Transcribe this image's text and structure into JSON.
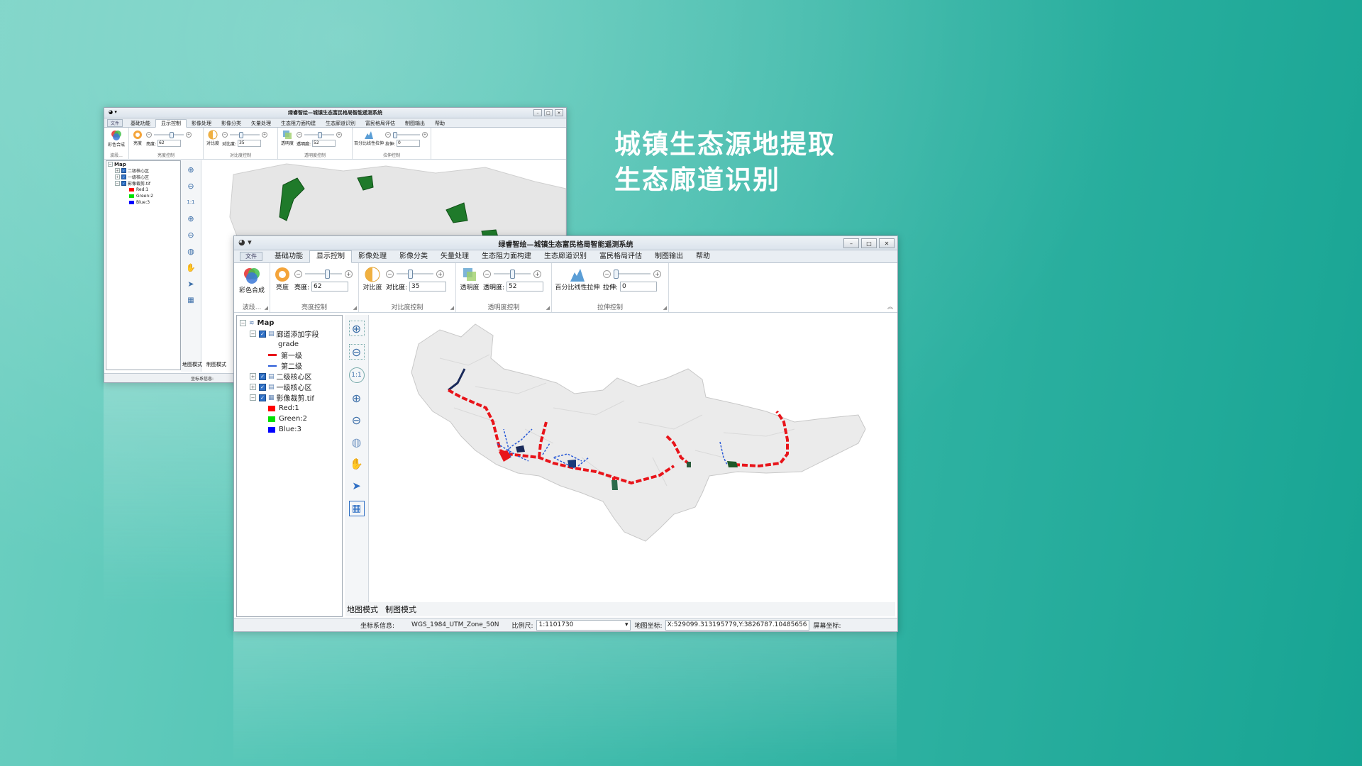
{
  "headline": {
    "line1": "城镇生态源地提取",
    "line2": "生态廊道识别"
  },
  "app": {
    "title": "绿睿智绘—城镇生态富民格局智能遥测系统",
    "file_tab": "文件",
    "tabs": [
      "基础功能",
      "显示控制",
      "影像处理",
      "影像分类",
      "矢量处理",
      "生态阻力面构建",
      "生态廊道识别",
      "富民格局评估",
      "制图输出",
      "帮助"
    ],
    "active_tab": "显示控制"
  },
  "ribbon": {
    "color_composite": "彩色合成",
    "band_group": "波段...",
    "brightness_btn": "亮度",
    "brightness_label": "亮度:",
    "brightness_value": "62",
    "brightness_group": "亮度控制",
    "contrast_btn": "对比度",
    "contrast_label": "对比度:",
    "contrast_value": "35",
    "contrast_group": "对比度控制",
    "transparency_btn": "透明度",
    "transparency_label": "透明度:",
    "transparency_value": "52",
    "transparency_group": "透明度控制",
    "stretch_btn": "百分比线性拉伸",
    "stretch_label": "拉伸:",
    "stretch_value": "0",
    "stretch_group": "拉伸控制",
    "slider_levels": {
      "brightness": 0.62,
      "contrast": 0.35,
      "transparency": 0.52,
      "stretch": 0.0
    }
  },
  "toc": {
    "root": "Map",
    "corridor_layer": "廊道添加字段",
    "grade_field": "grade",
    "level1": "第一级",
    "level2": "第二级",
    "core2": "二级核心区",
    "core1": "一级核心区",
    "raster": "影像裁剪.tif",
    "red": "Red:1",
    "green": "Green:2",
    "blue": "Blue:3"
  },
  "colors": {
    "red": "#ff0000",
    "green": "#00e000",
    "blue": "#0000ff",
    "corridor": "#e8141a",
    "secondary": "#2a5bd7",
    "core": "#1f7a2a"
  },
  "modes": {
    "map": "地图模式",
    "layout": "制图模式"
  },
  "status": {
    "crs_label": "坐标系信息:",
    "crs_value": "WGS_1984_UTM_Zone_50N",
    "scale_label": "比例尺:",
    "scale_value": "1:1101730",
    "mapcoord_label": "地图坐标:",
    "mapcoord_value": "X:529099.313195779,Y:3826787.10485656",
    "screencoord_label": "屏幕坐标:"
  },
  "icons": {
    "tools": [
      "zoom-box-in-icon",
      "zoom-box-out-icon",
      "zoom-1to1-icon",
      "zoom-in-icon",
      "zoom-out-icon",
      "globe-full-extent-icon",
      "hand-pan-icon",
      "select-pointer-icon",
      "layout-icon"
    ]
  }
}
